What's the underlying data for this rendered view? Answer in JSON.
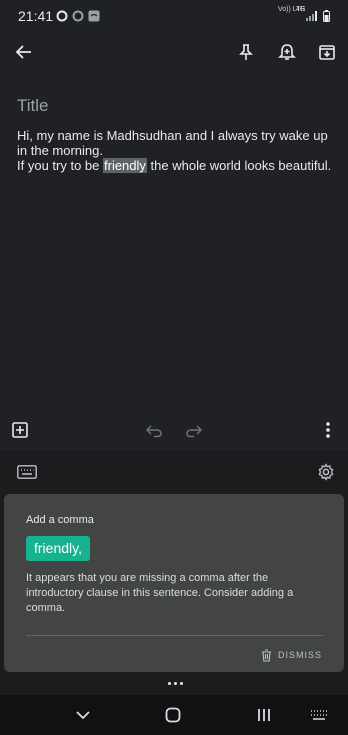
{
  "status": {
    "time": "21:41",
    "volte": "Vo)) LTE",
    "network": "4G"
  },
  "appbar": {
    "back_icon": "arrow-left-icon",
    "pin_icon": "pin-icon",
    "reminder_icon": "bell-plus-icon",
    "archive_icon": "archive-icon"
  },
  "note": {
    "title_placeholder": "Title",
    "body_line1": "Hi, my name is Madhsudhan and I always try wake up in the morning.",
    "body_line2_before": "If you try to be ",
    "body_highlight": "friendly",
    "body_line2_after": " the whole world looks beautiful."
  },
  "suggestion": {
    "title": "Add a comma",
    "chip": "friendly,",
    "description": "It appears that you are missing a comma after the introductory clause in this sentence. Consider adding a comma.",
    "dismiss_label": "DISMISS"
  },
  "colors": {
    "background": "#202124",
    "accent": "#17b28f",
    "card": "#424544"
  }
}
